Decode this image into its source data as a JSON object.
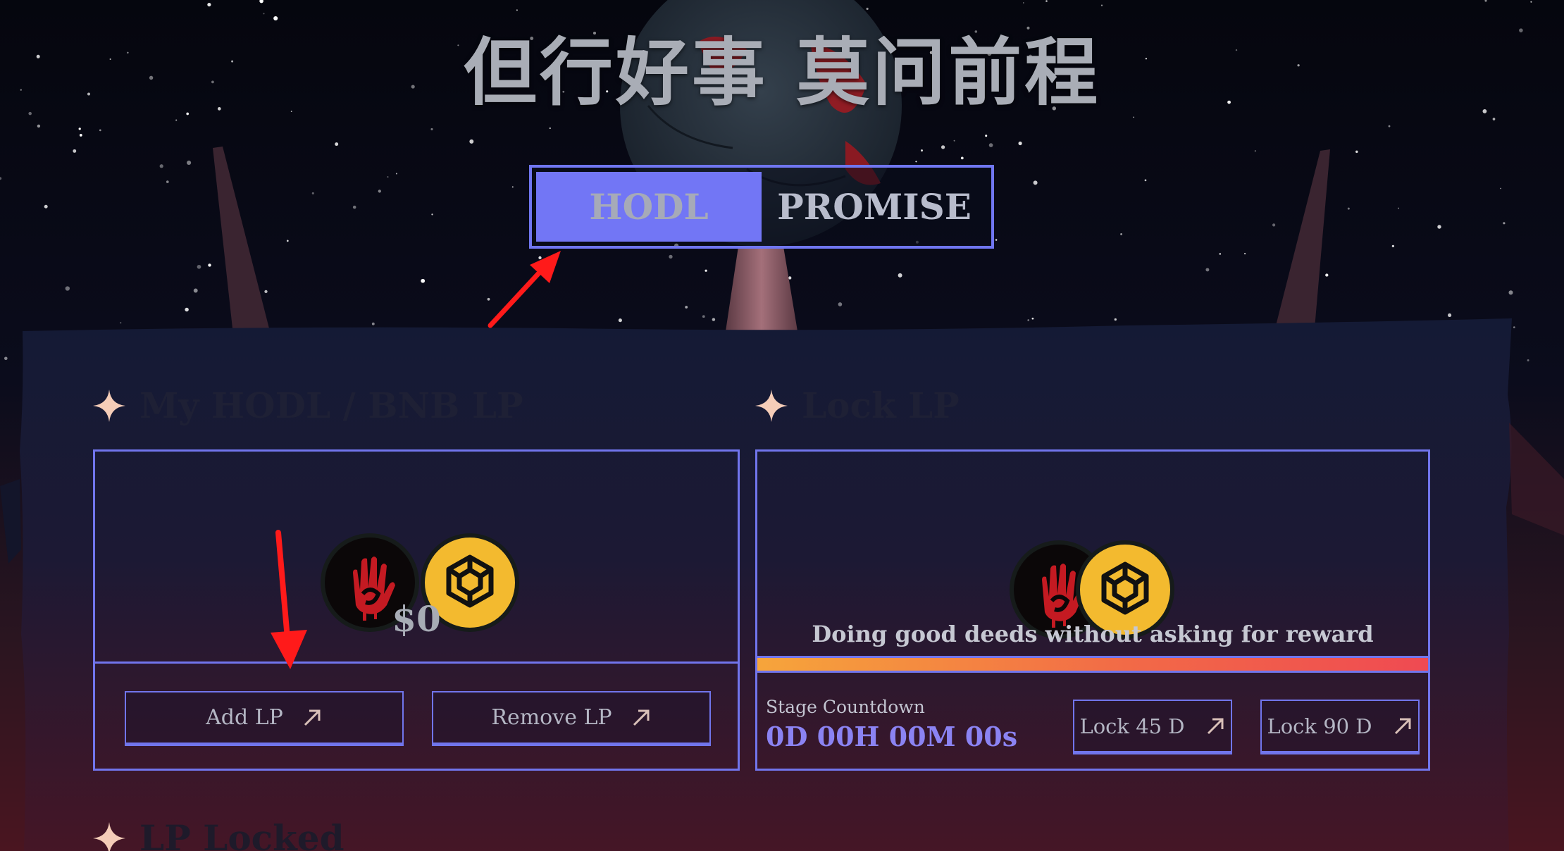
{
  "hero": {
    "title": "但行好事 莫问前程"
  },
  "tabs": [
    {
      "label": "HODL",
      "active": true
    },
    {
      "label": "PROMISE",
      "active": false
    }
  ],
  "my_lp": {
    "heading": "My HODL / BNB LP",
    "value": "$0",
    "buttons": {
      "add": "Add LP",
      "remove": "Remove LP"
    },
    "icons": [
      "hodl-token-icon",
      "bnb-token-icon",
      "arrow-up-right-icon"
    ]
  },
  "lock_lp": {
    "heading": "Lock LP",
    "tagline": "Doing good deeds without asking for reward",
    "progress_fraction": 1.0,
    "stage_label": "Stage Countdown",
    "countdown": "0D 00H 00M 00s",
    "buttons": {
      "lock_45": "Lock 45 D",
      "lock_90": "Lock 90 D"
    }
  },
  "lp_locked": {
    "heading": "LP Locked"
  },
  "colors": {
    "accent": "#7175ec",
    "active_tab": "#7276f5",
    "bnb_yellow": "#f3ba2f",
    "countdown": "#8b83f3",
    "annotation_red": "#ff1a1a",
    "sparkle": "#f5cdb8"
  }
}
